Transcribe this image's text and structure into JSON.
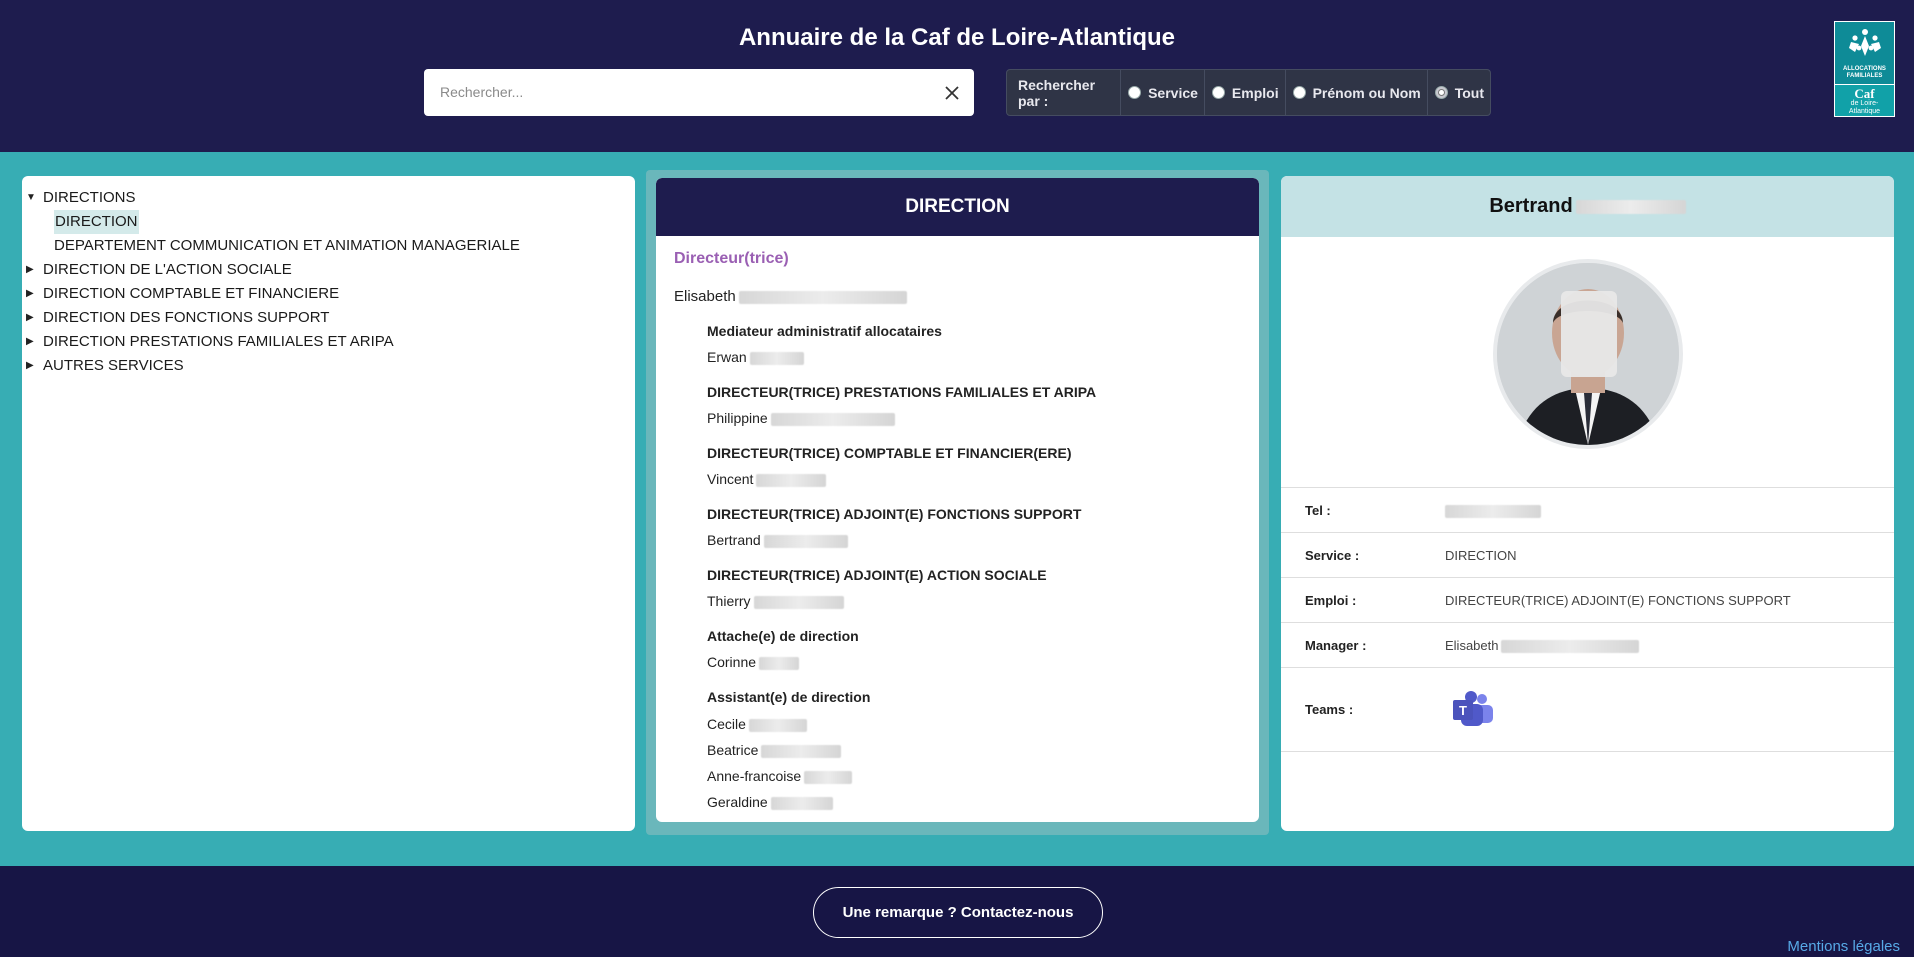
{
  "header": {
    "title": "Annuaire de la Caf de Loire-Atlantique",
    "search_placeholder": "Rechercher...",
    "radio_label": "Rechercher par :",
    "radio_options": [
      "Service",
      "Emploi",
      "Prénom ou Nom",
      "Tout"
    ],
    "radio_selected": "Tout",
    "logo": {
      "top_line1": "ALLOCATIONS",
      "top_line2": "FAMILIALES",
      "caf": "Caf",
      "sub1": "de Loire-",
      "sub2": "Atlantique"
    }
  },
  "tree": {
    "items": [
      {
        "label": "DIRECTIONS",
        "expanded": true,
        "level": 0
      },
      {
        "label": "DIRECTION",
        "level": 1,
        "selected": true
      },
      {
        "label": "DEPARTEMENT COMMUNICATION ET ANIMATION MANAGERIALE",
        "level": 1
      },
      {
        "label": "DIRECTION DE L'ACTION SOCIALE",
        "level": 0
      },
      {
        "label": "DIRECTION COMPTABLE ET FINANCIERE",
        "level": 0
      },
      {
        "label": "DIRECTION DES FONCTIONS SUPPORT",
        "level": 0
      },
      {
        "label": "DIRECTION PRESTATIONS FAMILIALES ET ARIPA",
        "level": 0
      },
      {
        "label": "AUTRES SERVICES",
        "level": 0
      }
    ]
  },
  "service": {
    "title": "DIRECTION",
    "main_role": "Directeur(trice)",
    "main_name": "Elisabeth",
    "members": [
      {
        "role": "Mediateur administratif allocataires",
        "names": [
          "Erwan"
        ]
      },
      {
        "role": "DIRECTEUR(TRICE) PRESTATIONS FAMILIALES ET ARIPA",
        "names": [
          "Philippine"
        ]
      },
      {
        "role": "DIRECTEUR(TRICE) COMPTABLE ET FINANCIER(ERE)",
        "names": [
          "Vincent"
        ]
      },
      {
        "role": "DIRECTEUR(TRICE) ADJOINT(E) FONCTIONS SUPPORT",
        "names": [
          "Bertrand"
        ]
      },
      {
        "role": "DIRECTEUR(TRICE) ADJOINT(E) ACTION SOCIALE",
        "names": [
          "Thierry"
        ]
      },
      {
        "role": "Attache(e) de direction",
        "names": [
          "Corinne"
        ]
      },
      {
        "role": "Assistant(e) de direction",
        "names": [
          "Cecile",
          "Beatrice",
          "Anne-francoise",
          "Geraldine"
        ]
      }
    ]
  },
  "detail": {
    "name": "Bertrand",
    "rows": {
      "tel_label": "Tel :",
      "service_label": "Service :",
      "service_value": "DIRECTION",
      "emploi_label": "Emploi :",
      "emploi_value": "DIRECTEUR(TRICE) ADJOINT(E) FONCTIONS SUPPORT",
      "manager_label": "Manager :",
      "manager_value": "Elisabeth",
      "teams_label": "Teams :"
    }
  },
  "footer": {
    "contact_label": "Une remarque ? Contactez-nous",
    "legal_label": "Mentions légales"
  },
  "colors": {
    "header_bg": "#1e1c4e",
    "main_bg": "#37adb4",
    "accent_role": "#9a5fb3",
    "detail_head_bg": "#c4e2e5",
    "link": "#57a9e6"
  }
}
